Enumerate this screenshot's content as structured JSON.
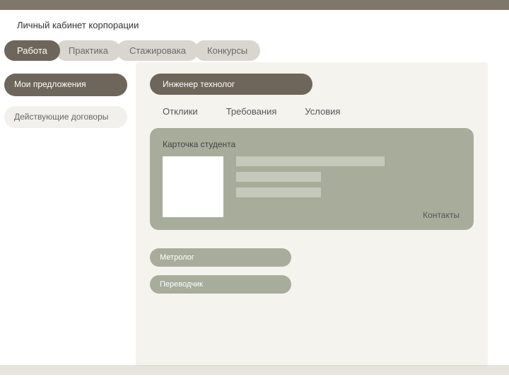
{
  "header": {
    "title": "Личный кабинет корпорации"
  },
  "nav": {
    "items": [
      {
        "label": "Работа",
        "active": true
      },
      {
        "label": "Практика",
        "active": false
      },
      {
        "label": "Стажировака",
        "active": false
      },
      {
        "label": "Конкурсы",
        "active": false
      }
    ]
  },
  "sidebar": {
    "items": [
      {
        "label": "Мои предложения",
        "active": true
      },
      {
        "label": "Действующие договоры",
        "active": false
      }
    ]
  },
  "content": {
    "job_title": "Инженер технолог",
    "subtabs": {
      "items": [
        {
          "label": "Отклики"
        },
        {
          "label": "Требования"
        },
        {
          "label": "Условия"
        }
      ]
    },
    "student_card": {
      "title": "Карточка студента",
      "contacts_label": "Контакты"
    },
    "collapsed": [
      {
        "label": "Метролог"
      },
      {
        "label": "Переводчик"
      }
    ]
  }
}
